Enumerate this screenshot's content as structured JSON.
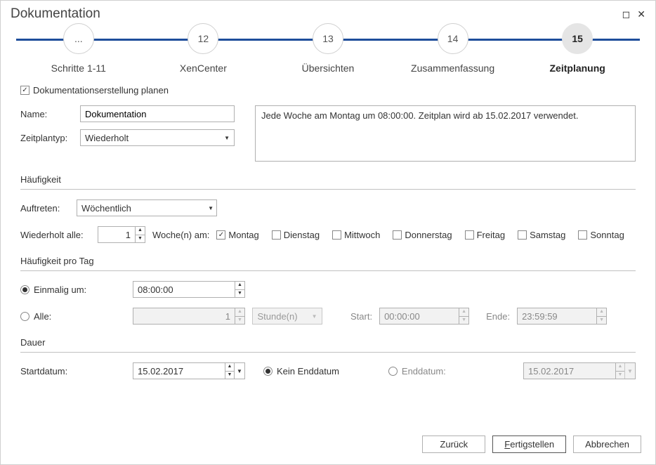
{
  "title": "Dokumentation",
  "stepper": {
    "steps": [
      {
        "circle": "...",
        "label": "Schritte 1-11"
      },
      {
        "circle": "12",
        "label": "XenCenter"
      },
      {
        "circle": "13",
        "label": "Übersichten"
      },
      {
        "circle": "14",
        "label": "Zusammenfassung"
      },
      {
        "circle": "15",
        "label": "Zeitplanung"
      }
    ]
  },
  "plan_checkbox": "Dokumentationserstellung planen",
  "name_label": "Name:",
  "name_value": "Dokumentation",
  "type_label": "Zeitplantyp:",
  "type_value": "Wiederholt",
  "description": "Jede Woche am Montag um 08:00:00. Zeitplan wird ab 15.02.2017 verwendet.",
  "freq": {
    "heading": "Häufigkeit",
    "auftreten_label": "Auftreten:",
    "auftreten_value": "Wöchentlich",
    "repeat_label": "Wiederholt alle:",
    "repeat_value": "1",
    "weeks_on": "Woche(n) am:",
    "days": {
      "mo": "Montag",
      "di": "Dienstag",
      "mi": "Mittwoch",
      "do": "Donnerstag",
      "fr": "Freitag",
      "sa": "Samstag",
      "so": "Sonntag"
    }
  },
  "perday": {
    "heading": "Häufigkeit pro Tag",
    "einmalig": "Einmalig um:",
    "einmalig_value": "08:00:00",
    "alle": "Alle:",
    "alle_value": "1",
    "unit": "Stunde(n)",
    "start_label": "Start:",
    "start_value": "00:00:00",
    "ende_label": "Ende:",
    "ende_value": "23:59:59"
  },
  "dauer": {
    "heading": "Dauer",
    "start_label": "Startdatum:",
    "start_value": "15.02.2017",
    "kein_end": "Kein Enddatum",
    "end_label": "Enddatum:",
    "end_value": "15.02.2017"
  },
  "buttons": {
    "zurueck": "Zurück",
    "fertig": "Fertigstellen",
    "abbrechen": "Abbrechen"
  }
}
